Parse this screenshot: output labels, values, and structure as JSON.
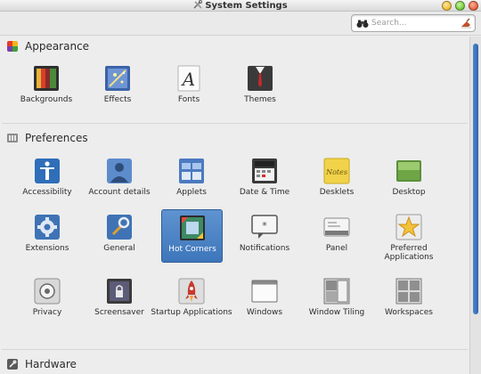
{
  "window": {
    "title": "System Settings"
  },
  "search": {
    "placeholder": "Search..."
  },
  "sections": {
    "appearance": {
      "label": "Appearance",
      "items": [
        {
          "label": "Backgrounds",
          "icon": "backgrounds-icon"
        },
        {
          "label": "Effects",
          "icon": "effects-icon"
        },
        {
          "label": "Fonts",
          "icon": "fonts-icon"
        },
        {
          "label": "Themes",
          "icon": "themes-icon"
        }
      ]
    },
    "preferences": {
      "label": "Preferences",
      "items": [
        {
          "label": "Accessibility",
          "icon": "accessibility-icon"
        },
        {
          "label": "Account details",
          "icon": "account-details-icon"
        },
        {
          "label": "Applets",
          "icon": "applets-icon"
        },
        {
          "label": "Date & Time",
          "icon": "date-time-icon"
        },
        {
          "label": "Desklets",
          "icon": "desklets-icon"
        },
        {
          "label": "Desktop",
          "icon": "desktop-icon"
        },
        {
          "label": "Extensions",
          "icon": "extensions-icon"
        },
        {
          "label": "General",
          "icon": "general-icon"
        },
        {
          "label": "Hot Corners",
          "icon": "hot-corners-icon",
          "selected": true
        },
        {
          "label": "Notifications",
          "icon": "notifications-icon"
        },
        {
          "label": "Panel",
          "icon": "panel-icon"
        },
        {
          "label": "Preferred Applications",
          "icon": "preferred-applications-icon"
        },
        {
          "label": "Privacy",
          "icon": "privacy-icon"
        },
        {
          "label": "Screensaver",
          "icon": "screensaver-icon"
        },
        {
          "label": "Startup Applications",
          "icon": "startup-applications-icon"
        },
        {
          "label": "Windows",
          "icon": "windows-icon"
        },
        {
          "label": "Window Tiling",
          "icon": "window-tiling-icon"
        },
        {
          "label": "Workspaces",
          "icon": "workspaces-icon"
        }
      ]
    },
    "hardware": {
      "label": "Hardware"
    }
  },
  "colors": {
    "selection": "#4a80c4",
    "scroll_thumb": "#3a74b8"
  }
}
